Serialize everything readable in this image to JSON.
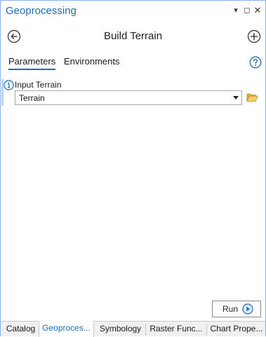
{
  "pane": {
    "title": "Geoprocessing",
    "controls": {
      "menu_icon": "chevron-down-icon",
      "maximize_icon": "maximize-icon",
      "close_icon": "close-icon",
      "menu_glyph": "▾",
      "maximize_glyph": "◻",
      "close_glyph": "✕"
    }
  },
  "header": {
    "tool_title": "Build Terrain",
    "back_icon": "back-arrow-icon",
    "add_icon": "add-icon"
  },
  "tabs": [
    {
      "label": "Parameters",
      "active": true
    },
    {
      "label": "Environments",
      "active": false
    }
  ],
  "help_icon": "help-icon",
  "parameters": [
    {
      "label": "Input Terrain",
      "value": "Terrain",
      "info_icon": "info-icon",
      "browse_icon": "folder-icon"
    }
  ],
  "run_button": {
    "label": "Run",
    "icon": "play-icon"
  },
  "bottom_tabs": [
    {
      "label": "Catalog",
      "active": false
    },
    {
      "label": "Geoproces...",
      "active": true
    },
    {
      "label": "Symbology",
      "active": false
    },
    {
      "label": "Raster Func...",
      "active": false
    },
    {
      "label": "Chart Prope...",
      "active": false
    }
  ],
  "colors": {
    "accent": "#1f6eb5",
    "border": "#8db2e3",
    "folder": "#e8b740"
  }
}
